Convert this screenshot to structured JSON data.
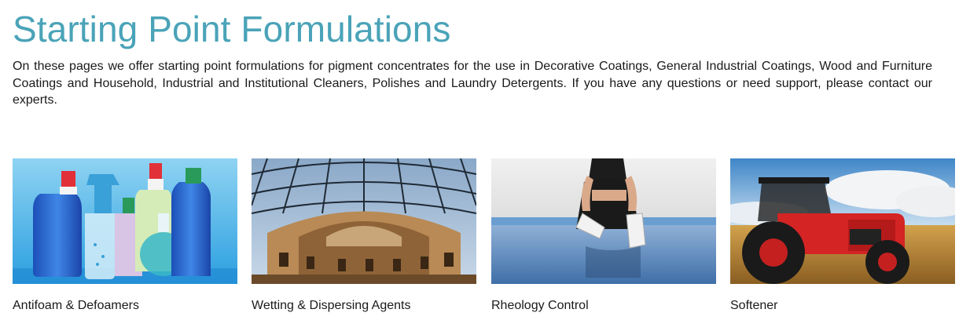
{
  "page": {
    "title": "Starting Point Formulations",
    "intro": "On these pages we offer starting point formulations for pigment concentrates for the use in Decorative Coatings, General Industrial Coatings, Wood and Furniture Coatings and Household, Industrial and Institutional Cleaners, Polishes and Laundry Detergents. If you have any questions or need support, please contact our experts."
  },
  "cards": [
    {
      "label": "Antifoam & Defoamers",
      "image": "cleaning-bottles-image"
    },
    {
      "label": "Wetting & Dispersing Agents",
      "image": "glass-dome-building-image"
    },
    {
      "label": "Rheology Control",
      "image": "person-sitting-on-floor-image"
    },
    {
      "label": "Softener",
      "image": "red-tractor-field-image"
    }
  ],
  "colors": {
    "title": "#4aa3b8",
    "text": "#1a1a1a"
  }
}
